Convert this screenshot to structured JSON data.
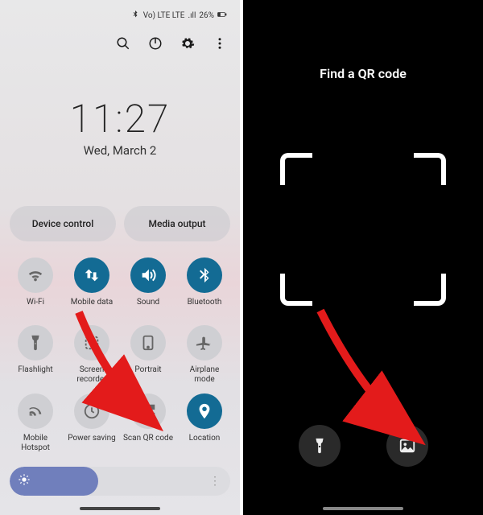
{
  "status": {
    "time_label": "11:27",
    "date_label": "Wed, March 2",
    "battery_pct": "26%",
    "carrier": "Vo) LTE LTE",
    "signal": ".ıll"
  },
  "action_icons": [
    "search-icon",
    "power-icon",
    "gear-icon",
    "more-icon"
  ],
  "pills": [
    {
      "label": "Device control"
    },
    {
      "label": "Media output"
    }
  ],
  "toggles": [
    {
      "name": "wifi",
      "label": "Wi-Fi",
      "icon": "wifi-icon",
      "active": false
    },
    {
      "name": "mobile-data",
      "label": "Mobile data",
      "icon": "swap-icon",
      "active": true
    },
    {
      "name": "sound",
      "label": "Sound",
      "icon": "volume-icon",
      "active": true
    },
    {
      "name": "bluetooth",
      "label": "Bluetooth",
      "icon": "bluetooth-icon",
      "active": true
    },
    {
      "name": "flashlight",
      "label": "Flashlight",
      "icon": "flashlight-icon",
      "active": false
    },
    {
      "name": "screen-rec",
      "label": "Screen recorder",
      "icon": "record-icon",
      "active": false
    },
    {
      "name": "portrait",
      "label": "Portrait",
      "icon": "portrait-icon",
      "active": false
    },
    {
      "name": "airplane",
      "label": "Airplane mode",
      "icon": "airplane-icon",
      "active": false
    },
    {
      "name": "hotspot",
      "label": "Mobile Hotspot",
      "icon": "hotspot-icon",
      "active": false
    },
    {
      "name": "power-saving",
      "label": "Power saving",
      "icon": "leaf-icon",
      "active": false
    },
    {
      "name": "scan-qr",
      "label": "Scan QR code",
      "icon": "qr-icon",
      "active": false
    },
    {
      "name": "location",
      "label": "Location",
      "icon": "location-icon",
      "active": true
    }
  ],
  "brightness": {
    "percent": 40
  },
  "qr_scanner": {
    "title": "Find a QR code",
    "buttons": [
      {
        "name": "flashlight",
        "icon": "flashlight-icon"
      },
      {
        "name": "gallery",
        "icon": "image-icon"
      }
    ]
  }
}
